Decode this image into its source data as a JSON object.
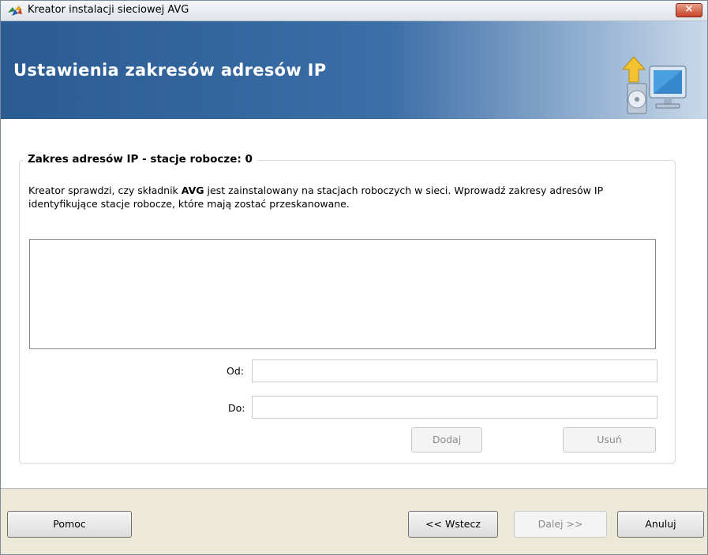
{
  "window": {
    "title": "Kreator instalacji sieciowej AVG",
    "close_label": "×"
  },
  "banner": {
    "title": "Ustawienia zakresów adresów IP",
    "icon": "computer-install-icon"
  },
  "group": {
    "legend": "Zakres adresów IP - stacje robocze: 0",
    "desc_part1": "Kreator sprawdzi, czy składnik ",
    "desc_bold": "AVG",
    "desc_part2": " jest zainstalowany na stacjach roboczych w sieci. Wprowadź zakresy adresów IP identyfikujące stacje robocze, które mają zostać przeskanowane."
  },
  "range_list": {
    "items": []
  },
  "from_field": {
    "label": "Od:",
    "value": ""
  },
  "to_field": {
    "label": "Do:",
    "value": ""
  },
  "buttons": {
    "add": "Dodaj",
    "remove": "Usuń",
    "help": "Pomoc",
    "back": "<< Wstecz",
    "next": "Dalej >>",
    "cancel": "Anuluj"
  },
  "colors": {
    "banner_start": "#2a5b92",
    "banner_end": "#c9d9ea",
    "footer_bg": "#ece9d8"
  }
}
